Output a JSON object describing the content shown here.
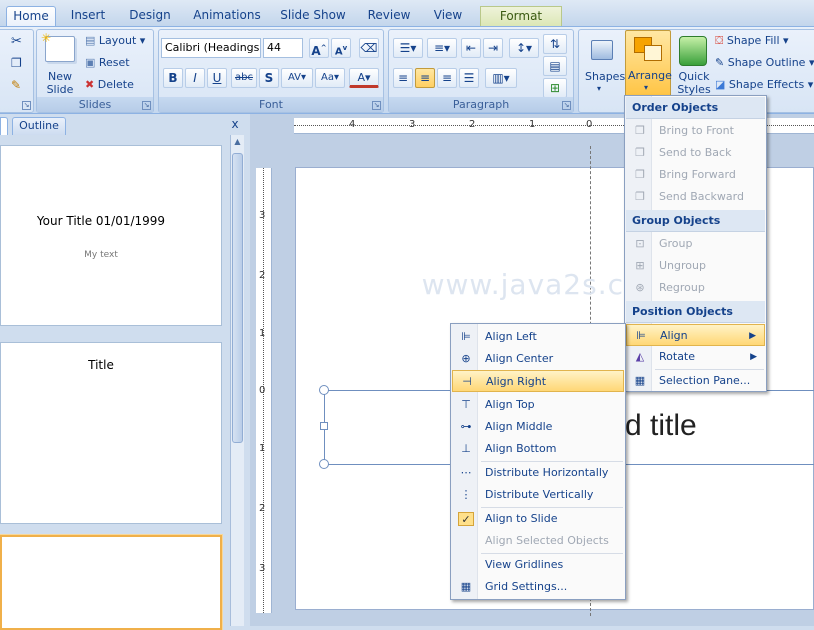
{
  "tabs": [
    {
      "label": "Home"
    },
    {
      "label": "Insert"
    },
    {
      "label": "Design"
    },
    {
      "label": "Animations"
    },
    {
      "label": "Slide Show"
    },
    {
      "label": "Review"
    },
    {
      "label": "View"
    },
    {
      "label": "Format"
    }
  ],
  "ribbon": {
    "slides": {
      "new_slide": "New Slide",
      "layout": "Layout",
      "reset": "Reset",
      "delete": "Delete",
      "label": "Slides"
    },
    "font": {
      "family": "Calibri (Headings",
      "size": "44",
      "label": "Font"
    },
    "paragraph": {
      "label": "Paragraph"
    },
    "drawing": {
      "shapes": "Shapes",
      "arrange": "Arrange",
      "quick_styles": "Quick Styles",
      "shape_fill": "Shape Fill",
      "shape_outline": "Shape Outline",
      "shape_effects": "Shape Effects"
    }
  },
  "left_pane": {
    "outline_tab": "Outline",
    "close": "x",
    "slides": [
      {
        "title": "Your Title 01/01/1999",
        "body": "My text"
      },
      {
        "title": "Title",
        "body": ""
      },
      {
        "title": "",
        "body": ""
      }
    ]
  },
  "slide": {
    "title_fragment": "d title",
    "watermark": "www.java2s.com"
  },
  "ruler": {
    "h_labels": [
      "4",
      "3",
      "2",
      "1",
      "0"
    ],
    "v_labels": [
      "3",
      "2",
      "1",
      "0",
      "1",
      "2",
      "3"
    ]
  },
  "arrange_menu": {
    "order_header": "Order Objects",
    "order_items": [
      "Bring to Front",
      "Send to Back",
      "Bring Forward",
      "Send Backward"
    ],
    "group_header": "Group Objects",
    "group_items": [
      "Group",
      "Ungroup",
      "Regroup"
    ],
    "position_header": "Position Objects",
    "position_items": [
      "Align",
      "Rotate",
      "Selection Pane..."
    ]
  },
  "align_menu": {
    "items": [
      "Align Left",
      "Align Center",
      "Align Right",
      "Align Top",
      "Align Middle",
      "Align Bottom"
    ],
    "distribute": [
      "Distribute Horizontally",
      "Distribute Vertically"
    ],
    "to_slide": "Align to Slide",
    "selected_objects": "Align Selected Objects",
    "gridlines": "View Gridlines",
    "grid_settings": "Grid Settings..."
  },
  "colors": {
    "accent": "#15428b",
    "highlight": "#ffd776"
  }
}
